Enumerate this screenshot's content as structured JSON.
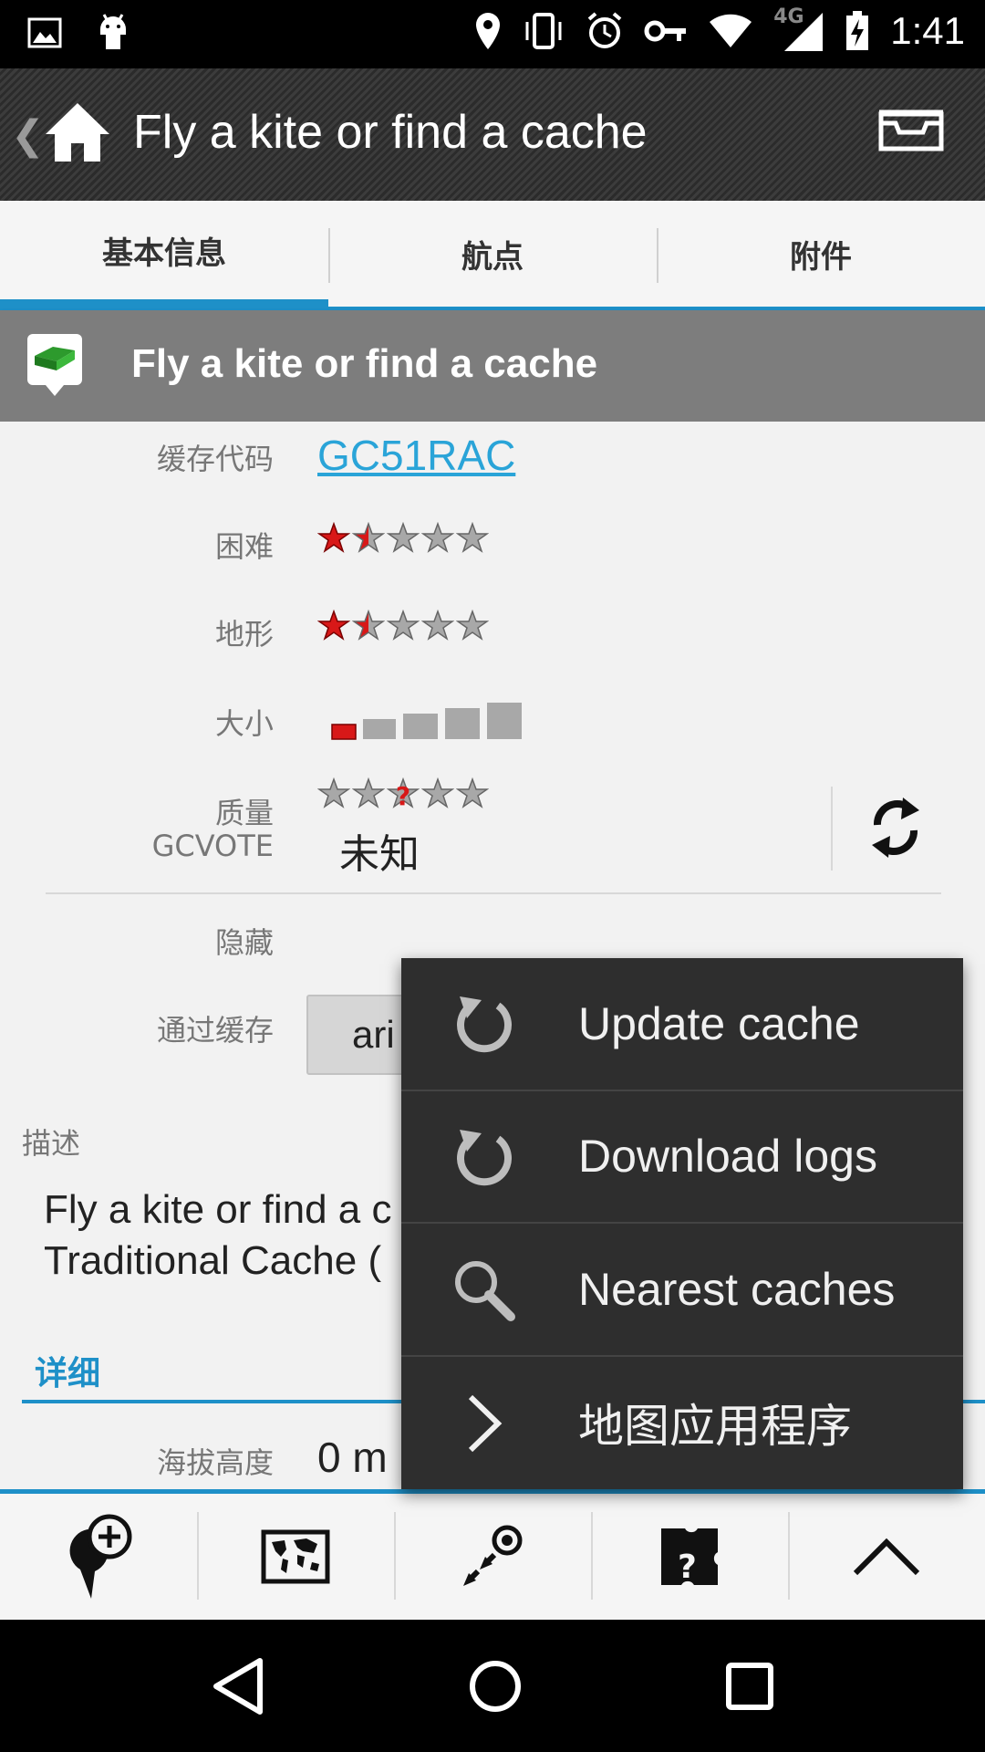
{
  "status_bar": {
    "time": "1:41",
    "network": "4G"
  },
  "action_bar": {
    "title": "Fly a kite or find a cache"
  },
  "tabs": [
    {
      "label": "基本信息",
      "active": true
    },
    {
      "label": "航点",
      "active": false
    },
    {
      "label": "附件",
      "active": false
    }
  ],
  "cache_header": {
    "title": "Fly a kite or find a cache"
  },
  "details": {
    "code_label": "缓存代码",
    "code_value": "GC51RAC",
    "difficulty_label": "困难",
    "difficulty_rating": 1.5,
    "terrain_label": "地形",
    "terrain_rating": 1.5,
    "size_label": "大小",
    "size_level": 1,
    "quality_label": "质量",
    "gcvote_label": "GCVOTE",
    "quality_value": "未知",
    "hidden_label": "隐藏",
    "owner_label": "通过缓存",
    "owner_value": "ari"
  },
  "description": {
    "label": "描述",
    "line1": "Fly a kite or find a c",
    "line2": "Traditional Cache ("
  },
  "section": {
    "title": "详细",
    "altitude_label": "海拔高度",
    "altitude_value": "0 m"
  },
  "menu": {
    "items": [
      {
        "label": "Update cache",
        "icon": "refresh-icon"
      },
      {
        "label": "Download logs",
        "icon": "refresh-icon"
      },
      {
        "label": "Nearest caches",
        "icon": "search-icon"
      },
      {
        "label": "地图应用程序",
        "icon": "chevron-right-icon"
      }
    ]
  },
  "bottom_bar": {
    "icons": [
      "add-waypoint-icon",
      "world-map-icon",
      "navigate-icon",
      "puzzle-icon",
      "chevron-up-icon"
    ]
  },
  "colors": {
    "accent": "#1e90c8",
    "link": "#2aa4d8",
    "star_red": "#d81818",
    "menu_bg": "#2e2e2e"
  }
}
